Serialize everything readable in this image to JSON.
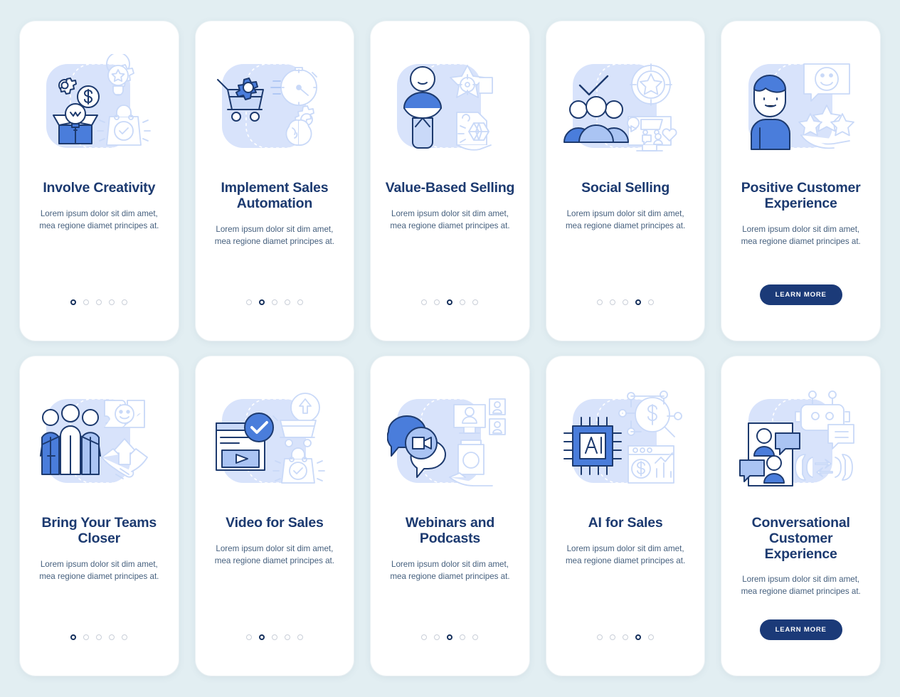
{
  "page": {
    "background_color": "#e2eef2",
    "card_background": "#ffffff",
    "title_color": "#1c3a70",
    "body_color": "#46607e",
    "accent_color": "#4a7ddb",
    "button_color": "#1b3a78",
    "illustration_bg": "#d6e2fb"
  },
  "shared": {
    "body_text": "Lorem ipsum dolor sit dim amet, mea regione diamet principes at.",
    "learn_more_label": "LEARN MORE",
    "dot_count": 5
  },
  "rows": [
    {
      "screens": [
        {
          "title": "Involve Creativity",
          "illustration": "creativity-illustration",
          "footer": "dots",
          "active_dot": 1
        },
        {
          "title": "Implement Sales Automation",
          "illustration": "sales-automation-illustration",
          "footer": "dots",
          "active_dot": 2
        },
        {
          "title": "Value-Based Selling",
          "illustration": "value-selling-illustration",
          "footer": "dots",
          "active_dot": 3
        },
        {
          "title": "Social Selling",
          "illustration": "social-selling-illustration",
          "footer": "dots",
          "active_dot": 4
        },
        {
          "title": "Positive Customer Experience",
          "illustration": "customer-experience-illustration",
          "footer": "button",
          "active_dot": 0
        }
      ]
    },
    {
      "screens": [
        {
          "title": "Bring Your Teams Closer",
          "illustration": "teams-illustration",
          "footer": "dots",
          "active_dot": 1
        },
        {
          "title": "Video for Sales",
          "illustration": "video-sales-illustration",
          "footer": "dots",
          "active_dot": 2
        },
        {
          "title": "Webinars and Podcasts",
          "illustration": "webinars-illustration",
          "footer": "dots",
          "active_dot": 3
        },
        {
          "title": "AI for Sales",
          "illustration": "ai-sales-illustration",
          "footer": "dots",
          "active_dot": 4
        },
        {
          "title": "Conversational Customer Experience",
          "illustration": "conversational-illustration",
          "footer": "button",
          "active_dot": 0
        }
      ]
    }
  ]
}
